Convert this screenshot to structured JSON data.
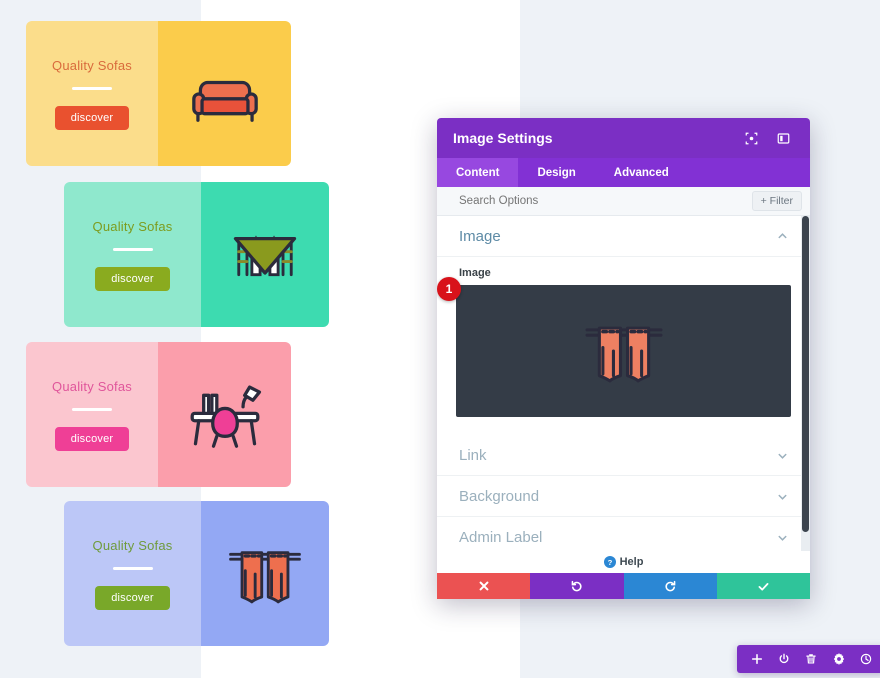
{
  "page": {
    "background_color": "#eef2f7",
    "content_background": "#ffffff"
  },
  "cards": [
    {
      "title": "Quality Sofas",
      "button_label": "discover",
      "icon": "sofa-icon",
      "left_bg": "#fbdd8b",
      "right_bg": "#fbcc4b",
      "title_color": "#d96b3c",
      "button_color": "#e9512f"
    },
    {
      "title": "Quality Sofas",
      "button_label": "discover",
      "icon": "dining-table-chairs-icon",
      "left_bg": "#8fe8cd",
      "right_bg": "#3ddbb0",
      "title_color": "#7d9c1e",
      "button_color": "#8aab1f"
    },
    {
      "title": "Quality Sofas",
      "button_label": "discover",
      "icon": "desk-chair-lamp-icon",
      "left_bg": "#fbc6cf",
      "right_bg": "#fb9eab",
      "title_color": "#e0569b",
      "button_color": "#ef3f96"
    },
    {
      "title": "Quality Sofas",
      "button_label": "discover",
      "icon": "curtains-icon",
      "left_bg": "#bcc7f7",
      "right_bg": "#93a8f4",
      "title_color": "#6f9b3c",
      "button_color": "#79a829"
    }
  ],
  "modal": {
    "title": "Image Settings",
    "header_color": "#7b2fc4",
    "header_icons": [
      {
        "name": "expand-fullscreen-icon"
      },
      {
        "name": "panel-layout-icon"
      }
    ],
    "tabs": [
      {
        "label": "Content",
        "active": true
      },
      {
        "label": "Design",
        "active": false
      },
      {
        "label": "Advanced",
        "active": false
      }
    ],
    "search": {
      "placeholder": "Search Options",
      "value": ""
    },
    "filter_button": "+ Filter",
    "sections": [
      {
        "label": "Image",
        "open": true
      },
      {
        "label": "Link",
        "open": false
      },
      {
        "label": "Background",
        "open": false
      },
      {
        "label": "Admin Label",
        "open": false
      }
    ],
    "image_field": {
      "label": "Image",
      "preview_icon": "curtains-icon",
      "preview_background": "#343c47",
      "badge": "1",
      "badge_color": "#d8121a"
    },
    "help_label": "Help",
    "actions": [
      {
        "name": "close-button",
        "icon": "cross-icon",
        "color": "#eb5252"
      },
      {
        "name": "undo-button",
        "icon": "undo-arrow-icon",
        "color": "#7b2fc4"
      },
      {
        "name": "redo-button",
        "icon": "redo-arrow-icon",
        "color": "#2b87d4"
      },
      {
        "name": "save-button",
        "icon": "checkmark-icon",
        "color": "#2fc49a"
      }
    ]
  },
  "bottom_toolbar": {
    "background_color": "#7b2fc4",
    "icons": [
      {
        "name": "plus-icon"
      },
      {
        "name": "power-icon"
      },
      {
        "name": "trash-icon"
      },
      {
        "name": "gear-icon"
      },
      {
        "name": "history-clock-icon"
      }
    ]
  }
}
